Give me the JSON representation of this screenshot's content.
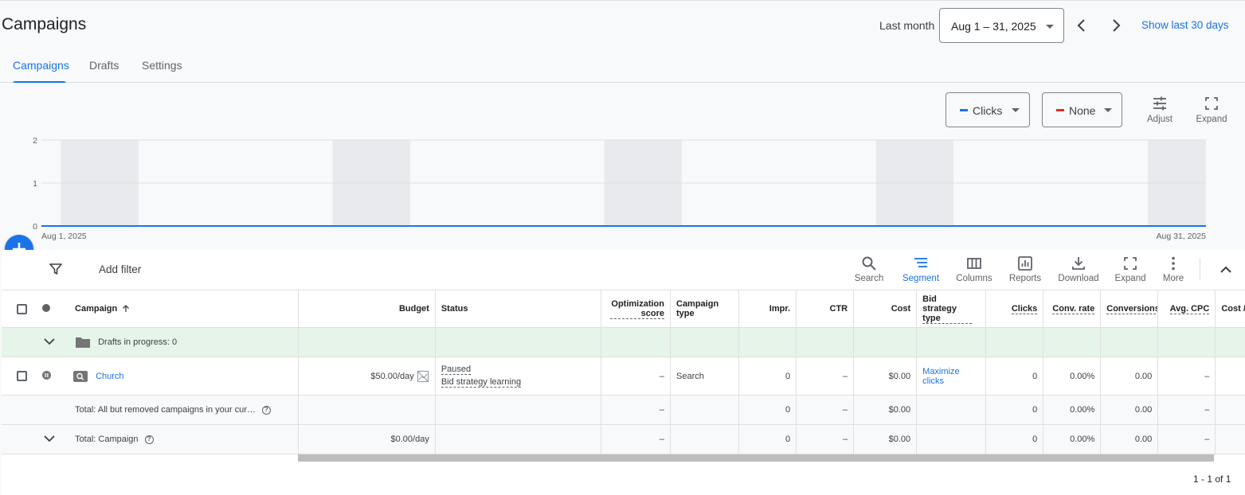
{
  "header": {
    "title": "Campaigns",
    "date_range_label": "Last month",
    "date_range_value": "Aug 1 – 31, 2025",
    "show_last_30": "Show last 30 days"
  },
  "tabs": [
    {
      "label": "Campaigns",
      "active": true
    },
    {
      "label": "Drafts",
      "active": false
    },
    {
      "label": "Settings",
      "active": false
    }
  ],
  "chart_controls": {
    "metric1": {
      "label": "Clicks",
      "color": "#1a73e8"
    },
    "metric2": {
      "label": "None",
      "color": "#d93025"
    },
    "adjust_label": "Adjust",
    "expand_label": "Expand"
  },
  "chart_data": {
    "type": "line",
    "x": [
      "Aug 1, 2025",
      "Aug 31, 2025"
    ],
    "x_tick_labels": [
      "Aug 1, 2025",
      "Aug 31, 2025"
    ],
    "series": [
      {
        "name": "Clicks",
        "values": [
          0,
          0
        ],
        "color": "#1a73e8"
      }
    ],
    "ylim": [
      0,
      2
    ],
    "y_ticks": [
      "0",
      "1",
      "2"
    ],
    "grid": true
  },
  "toolbar": {
    "add_filter": "Add filter",
    "tools": [
      {
        "label": "Search",
        "icon": "search-icon",
        "active": false
      },
      {
        "label": "Segment",
        "icon": "segment-icon",
        "active": true
      },
      {
        "label": "Columns",
        "icon": "columns-icon",
        "active": false
      },
      {
        "label": "Reports",
        "icon": "reports-icon",
        "active": false
      },
      {
        "label": "Download",
        "icon": "download-icon",
        "active": false
      },
      {
        "label": "Expand",
        "icon": "expand-icon",
        "active": false
      },
      {
        "label": "More",
        "icon": "more-vert-icon",
        "active": false
      }
    ]
  },
  "table": {
    "columns": {
      "campaign": "Campaign",
      "budget": "Budget",
      "status": "Status",
      "optimization_score": "Optimization score",
      "campaign_type": "Campaign type",
      "impr": "Impr.",
      "ctr": "CTR",
      "cost": "Cost",
      "bid_strategy_type": "Bid strategy type",
      "clicks": "Clicks",
      "conv_rate": "Conv. rate",
      "conversions": "Conversions",
      "avg_cpc": "Avg. CPC",
      "cost_per": "Cost /"
    },
    "drafts_row": {
      "label": "Drafts in progress: 0"
    },
    "campaign_row": {
      "name": "Church",
      "budget": "$50.00/day",
      "status_main": "Paused",
      "status_sub": "Bid strategy learning",
      "optimization_score": "–",
      "campaign_type": "Search",
      "impr": "0",
      "ctr": "–",
      "cost": "$0.00",
      "bid_strategy": "Maximize clicks",
      "clicks": "0",
      "conv_rate": "0.00%",
      "conversions": "0.00",
      "avg_cpc": "–"
    },
    "total_all": {
      "label": "Total: All but removed campaigns in your cur…",
      "optimization_score": "–",
      "impr": "0",
      "ctr": "–",
      "cost": "$0.00",
      "clicks": "0",
      "conv_rate": "0.00%",
      "conversions": "0.00",
      "avg_cpc": "–"
    },
    "total_campaign": {
      "label": "Total: Campaign",
      "budget": "$0.00/day",
      "optimization_score": "–",
      "impr": "0",
      "ctr": "–",
      "cost": "$0.00",
      "clicks": "0",
      "conv_rate": "0.00%",
      "conversions": "0.00",
      "avg_cpc": "–"
    }
  },
  "pagination": "1 - 1 of 1"
}
